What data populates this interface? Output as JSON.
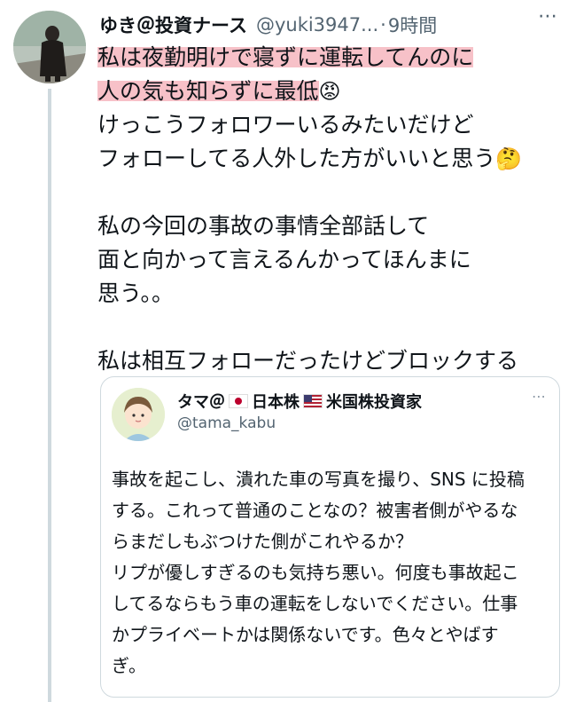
{
  "post": {
    "author_name": "ゆき＠投資ナース",
    "author_handle": "@yuki3947...",
    "dot": "·",
    "time": "9時間",
    "more_icon": "⋯",
    "lines": [
      "私は夜勤明けで寝ずに運転してんのに",
      "人の気も知らずに最低",
      "けっこうフォロワーいるみたいだけど",
      "フォローしてる人外した方がいいと思う",
      "",
      "私の今回の事故の事情全部話して",
      "面と向かって言えるんかってほんまに",
      "思う。。",
      "",
      "私は相互フォローだったけどブロックする"
    ],
    "emoji_angry": "😡",
    "emoji_thinking": "🤔",
    "highlight_color": "#f7c1c8"
  },
  "quote": {
    "author_name": "タマ＠",
    "name_part2": "日本株",
    "name_part3": "米国株投資家",
    "author_handle": "@tama_kabu",
    "more_icon": "⋯",
    "lines": [
      "事故を起こし、潰れた車の写真を撮り、SNS に投稿",
      "する。これって普通のことなの？被害者側がやるな",
      "らまだしもぶつけた側がこれやるか？",
      "リプが優しすぎるのも気持ち悪い。何度も事故起こ",
      "してるならもう車の運転をしないでください。仕事",
      "かプライベートかは関係ないです。色々とやばす",
      "ぎ。"
    ]
  }
}
